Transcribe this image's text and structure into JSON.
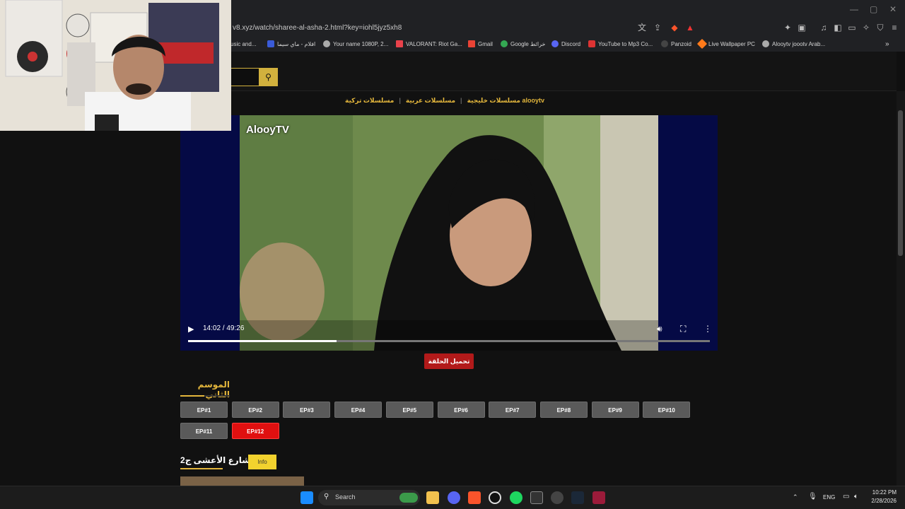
{
  "browser": {
    "url": "v8.xyz/watch/sharee-al-asha-2.html?key=iohl5jyz5xh8",
    "bookmarks": [
      {
        "label": "usic and...",
        "color": "#888888"
      },
      {
        "label": "افلام - ماي سيما",
        "color": "#3a5bd8"
      },
      {
        "label": "Your name 1080P, 2...",
        "color": "#aaaaaa"
      },
      {
        "label": "VALORANT: Riot Ga...",
        "color": "#e8424b"
      },
      {
        "label": "Gmail",
        "color": "#ea4335"
      },
      {
        "label": "Google خرائط",
        "color": "#34a853"
      },
      {
        "label": "Discord",
        "color": "#5865f2"
      },
      {
        "label": "YouTube to Mp3 Co...",
        "color": "#d33"
      },
      {
        "label": "Panzoid",
        "color": "#444444"
      },
      {
        "label": "Live Wallpaper PC",
        "color": "#ff7a1a"
      },
      {
        "label": "Alooytv joootv Arab...",
        "color": "#aaaaaa"
      }
    ]
  },
  "site": {
    "categories": [
      "alooytv مسلسلات خليجية",
      "مسلسلات عربية",
      "مسلسلات تركية"
    ],
    "accent": "#e3b63c"
  },
  "player": {
    "watermark": "AlooyTV",
    "time": "14:02 / 49:26",
    "progress": 0.284
  },
  "download_label": "تحميل الحلقة",
  "season_title": "الموسم الثاني",
  "episodes": [
    {
      "label": "EP#1",
      "active": false
    },
    {
      "label": "EP#2",
      "active": false
    },
    {
      "label": "EP#3",
      "active": false
    },
    {
      "label": "EP#4",
      "active": false
    },
    {
      "label": "EP#5",
      "active": false
    },
    {
      "label": "EP#6",
      "active": false
    },
    {
      "label": "EP#7",
      "active": false
    },
    {
      "label": "EP#8",
      "active": false
    },
    {
      "label": "EP#9",
      "active": false
    },
    {
      "label": "EP#10",
      "active": false
    },
    {
      "label": "EP#11",
      "active": false
    },
    {
      "label": "EP#12",
      "active": true
    }
  ],
  "show": {
    "title": "شارع الأعشى ج2",
    "info_label": "Info"
  },
  "taskbar": {
    "search_label": "Search",
    "lang": "ENG",
    "time": "10:22 PM",
    "date": "2/28/2026"
  }
}
